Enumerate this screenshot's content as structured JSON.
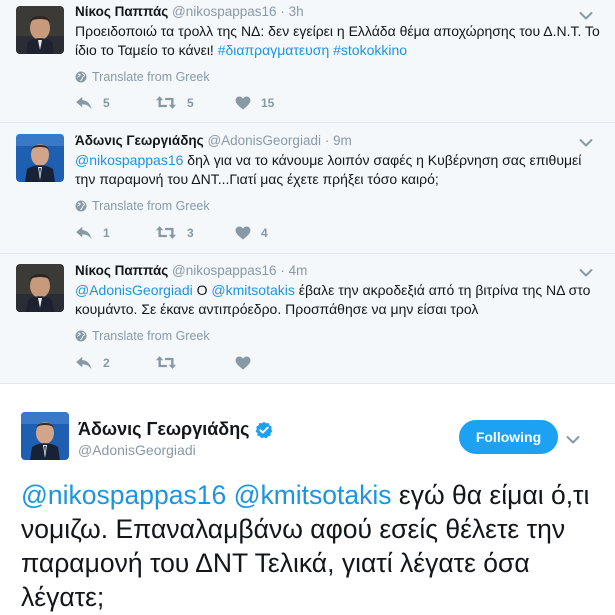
{
  "thread": [
    {
      "fullname": "Νίκος Παππάς",
      "username": "@nikospappas16",
      "time": "3h",
      "text_plain_1": "Προειδοποιώ τα τρολλ της ΝΔ: δεν εγείρει η Ελλάδα θέμα αποχώρησης του Δ.Ν.Τ. Το ίδιο το Ταμείο το κάνει! ",
      "hashtag_1": "#διαπραγματευση",
      "hashtag_2": "#stokokkino",
      "translate": "Translate from Greek",
      "replies": "5",
      "retweets": "5",
      "likes": "15"
    },
    {
      "fullname": "Άδωνις Γεωργιάδης",
      "username": "@AdonisGeorgiadi",
      "time": "9m",
      "mention_1": "@nikospappas16",
      "text_plain_1": " δηλ για να το κάνουμε λοιπόν σαφές η Κυβέρνηση σας επιθυμεί την παραμονή του ΔΝΤ...Γιατί μας έχετε πρήξει τόσο καιρό;",
      "translate": "Translate from Greek",
      "replies": "1",
      "retweets": "3",
      "likes": "4"
    },
    {
      "fullname": "Νίκος Παππάς",
      "username": "@nikospappas16",
      "time": "4m",
      "mention_1": "@AdonisGeorgiadi",
      "text_plain_1": " Ο ",
      "mention_2": "@kmitsotakis",
      "text_plain_2": "  έβαλε την ακροδεξιά από τη βιτρίνα της ΝΔ στο κουμάντο. Σε έκανε αντιπρόεδρο. Προσπάθησε να μην είσαι τρολ",
      "translate": "Translate from Greek",
      "replies": "2",
      "retweets": "",
      "likes": ""
    }
  ],
  "main_tweet": {
    "fullname": "Άδωνις Γεωργιάδης",
    "username": "@AdonisGeorgiadi",
    "follow_label": "Following",
    "mention_1": "@nikospappas16",
    "mention_2": "@kmitsotakis",
    "text_plain": "  εγώ θα είμαι ό,τι νομιζω. Επαναλαμβάνω αφού εσείς θέλετε την παραμονή του ΔΝΤ Τελικά, γιατί λέγατε όσα λέγατε;"
  },
  "colors": {
    "link": "#1b95e0",
    "follow_button": "#1da1f2",
    "muted": "#8899a6",
    "thread_bg": "#f5f8fa"
  },
  "icons": [
    "reply-icon",
    "retweet-icon",
    "like-icon",
    "globe-icon",
    "caret-down-icon",
    "verified-badge-icon"
  ]
}
